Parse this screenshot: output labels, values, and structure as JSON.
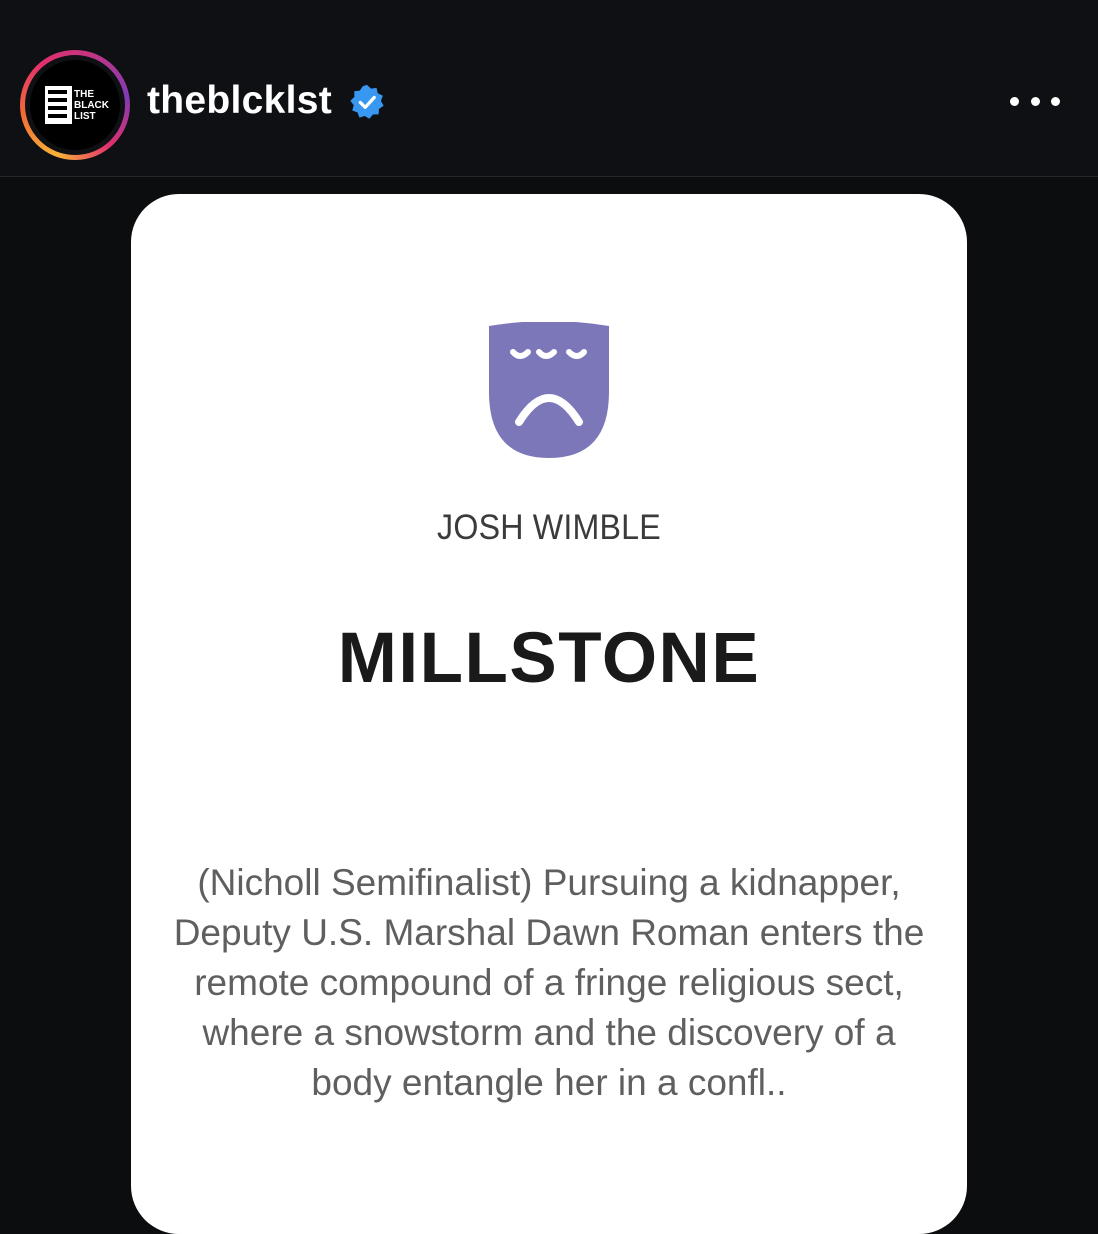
{
  "post_header": {
    "username": "theblcklst",
    "avatar_text": [
      "THE",
      "BLACK",
      "LIST"
    ],
    "verified": true,
    "more_icon": "ellipsis-horizontal-icon"
  },
  "card": {
    "icon": "sad-theater-mask-icon",
    "icon_color": "#7b77b8",
    "author": "JOSH WIMBLE",
    "title": "MILLSTONE",
    "logline": "(Nicholl Semifinalist) Pursuing a kidnapper, Deputy U.S. Marshal Dawn Roman enters the remote compound of a fringe religious sect, where a snowstorm and the discovery of a body entangle her in a confl.."
  },
  "colors": {
    "background": "#0c0d0f",
    "header": "#0e1014",
    "verified_badge": "#3897f0",
    "card": "#ffffff"
  }
}
